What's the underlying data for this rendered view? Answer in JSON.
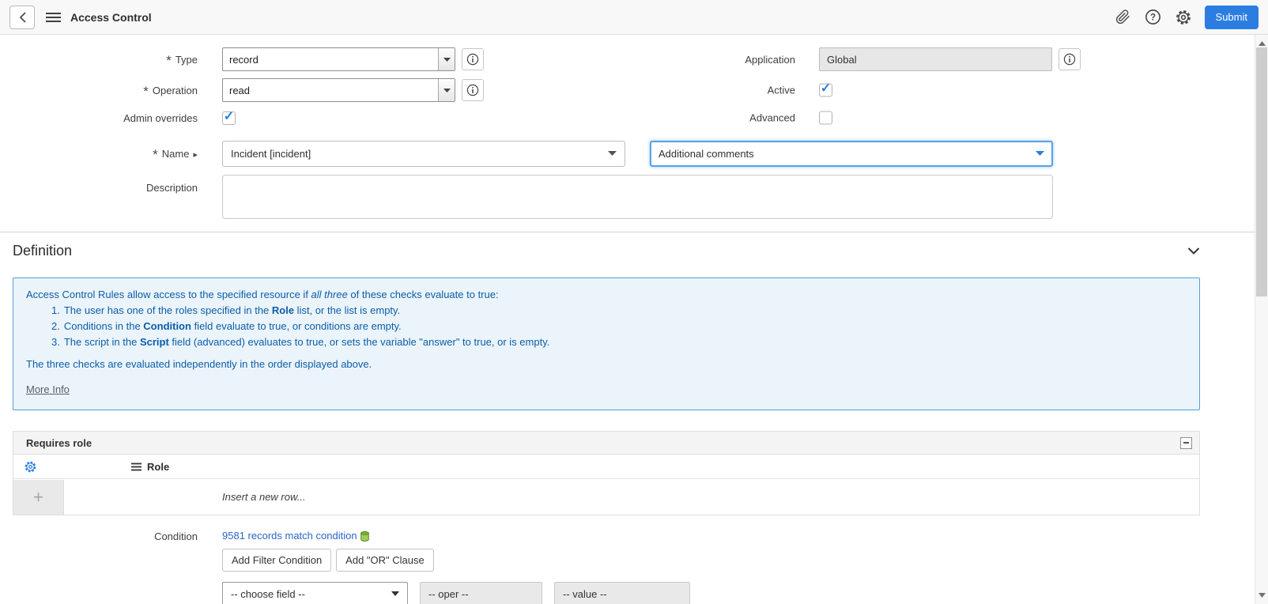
{
  "colors": {
    "accent": "#2a7de1",
    "submit": "#2b7de1",
    "info-bg": "#ebf4fb",
    "info-border": "#539ed0",
    "info-text": "#0c5ea8",
    "link": "#2b66c9"
  },
  "icons": {
    "required": "*",
    "check": "✓",
    "plus": "+",
    "name_expand": "▸"
  },
  "header": {
    "title": "Access Control",
    "submit": "Submit"
  },
  "form": {
    "type": {
      "label": "Type",
      "value": "record",
      "required": true
    },
    "operation": {
      "label": "Operation",
      "value": "read",
      "required": true
    },
    "admin_overrides": {
      "label": "Admin overrides",
      "checked": true
    },
    "name": {
      "label": "Name",
      "table": "Incident [incident]",
      "field": "Additional comments",
      "required": true
    },
    "description": {
      "label": "Description",
      "value": ""
    },
    "application": {
      "label": "Application",
      "value": "Global"
    },
    "active": {
      "label": "Active",
      "checked": true
    },
    "advanced": {
      "label": "Advanced",
      "checked": false
    }
  },
  "definition": {
    "title": "Definition",
    "intro_prefix": "Access Control Rules allow access to the specified resource if ",
    "intro_em": "all three",
    "intro_suffix": " of these checks evaluate to true:",
    "items": [
      {
        "num": "1.",
        "pre": "The user has one of the roles specified in the ",
        "bold": "Role",
        "post": " list, or the list is empty."
      },
      {
        "num": "2.",
        "pre": "Conditions in the ",
        "bold": "Condition",
        "post": " field evaluate to true, or conditions are empty."
      },
      {
        "num": "3.",
        "pre": "The script in the ",
        "bold": "Script",
        "post": " field (advanced) evaluates to true, or sets the variable \"answer\" to true, or is empty."
      }
    ],
    "footer": "The three checks are evaluated independently in the order displayed above.",
    "more_info": "More Info"
  },
  "requires_role": {
    "title": "Requires role",
    "role_column": "Role",
    "insert_row": "Insert a new row..."
  },
  "condition": {
    "label": "Condition",
    "match_link": "9581 records match condition",
    "add_filter": "Add Filter Condition",
    "add_or": "Add \"OR\" Clause",
    "choose_field": "-- choose field --",
    "oper": "-- oper --",
    "value": "-- value --"
  }
}
